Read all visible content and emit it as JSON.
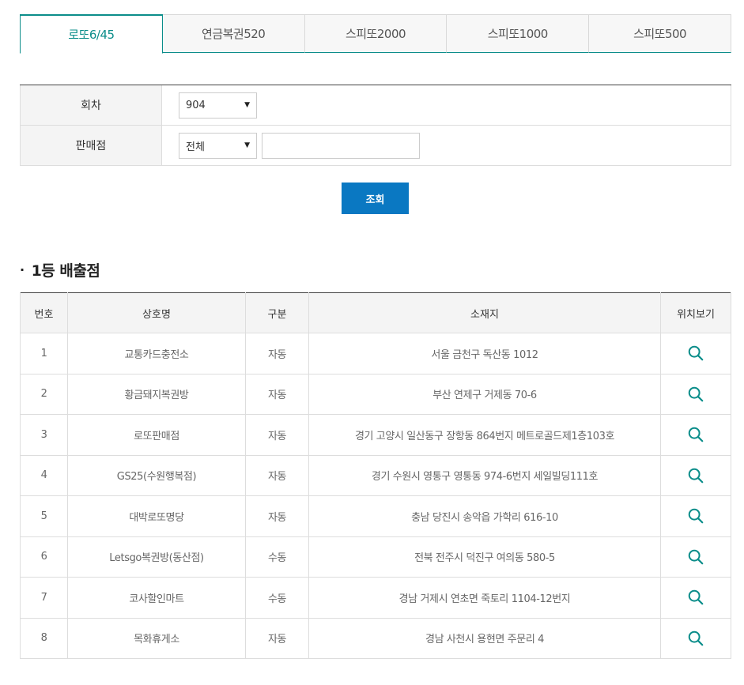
{
  "tabs": [
    {
      "label": "로또6/45",
      "active": true
    },
    {
      "label": "연금복권520",
      "active": false
    },
    {
      "label": "스피또2000",
      "active": false
    },
    {
      "label": "스피또1000",
      "active": false
    },
    {
      "label": "스피또500",
      "active": false
    }
  ],
  "form": {
    "round_label": "회차",
    "round_value": "904",
    "store_label": "판매점",
    "store_region_value": "전체",
    "store_name_value": "",
    "submit_label": "조회"
  },
  "section_title": "1등 배출점",
  "table": {
    "headers": [
      "번호",
      "상호명",
      "구분",
      "소재지",
      "위치보기"
    ],
    "rows": [
      [
        "1",
        "교통카드충전소",
        "자동",
        "서울 금천구 독산동 1012"
      ],
      [
        "2",
        "황금돼지복권방",
        "자동",
        "부산 연제구 거제동 70-6"
      ],
      [
        "3",
        "로또판매점",
        "자동",
        "경기 고양시 일산동구 장항동 864번지 메트로골드제1층103호"
      ],
      [
        "4",
        "GS25(수원행복점)",
        "자동",
        "경기 수원시 영통구 영통동 974-6번지 세일빌딩111호"
      ],
      [
        "5",
        "대박로또명당",
        "자동",
        "충남 당진시 송악읍 가학리 616-10"
      ],
      [
        "6",
        "Letsgo복권방(동산점)",
        "수동",
        "전북 전주시 덕진구 여의동 580-5"
      ],
      [
        "7",
        "코사할인마트",
        "수동",
        "경남 거제시 연초면 죽토리 1104-12번지"
      ],
      [
        "8",
        "목화휴게소",
        "자동",
        "경남 사천시 용현면 주문리 4"
      ]
    ]
  },
  "colors": {
    "accent": "#0b8d8a",
    "button": "#0a78c2",
    "header_bg": "#f4f4f4"
  },
  "icons": {
    "location": "search-icon",
    "dropdown": "chevron-down-icon"
  }
}
